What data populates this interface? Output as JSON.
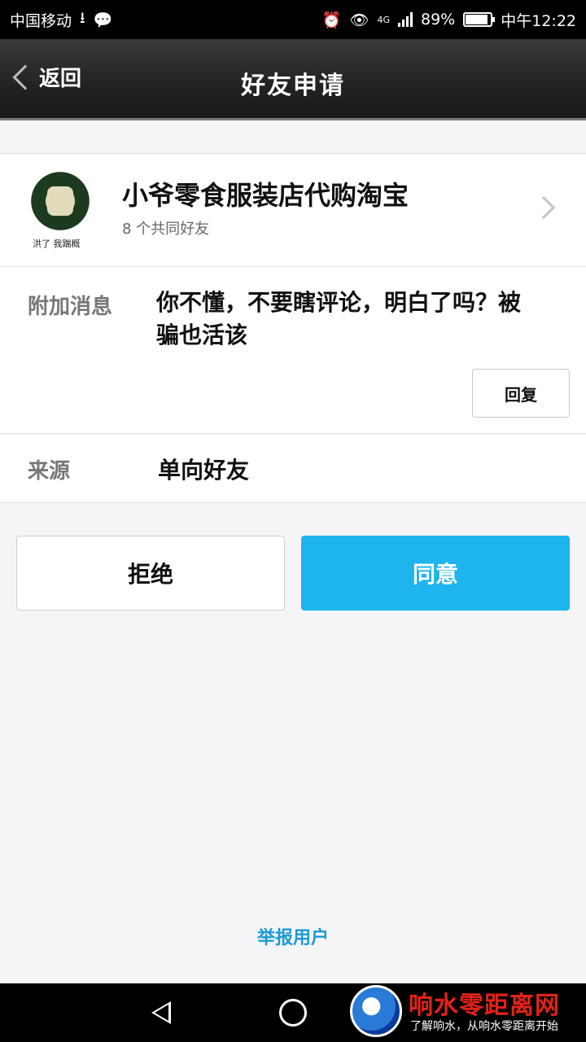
{
  "status_bar": {
    "carrier": "中国移动",
    "battery": "89%",
    "battery_level": 0.89,
    "network": "4G",
    "time": "中午12:22",
    "icons": [
      "download-icon",
      "wechat-icon",
      "alarm-icon",
      "eye-icon",
      "signal-icon",
      "battery-icon"
    ]
  },
  "header": {
    "back_label": "返回",
    "title": "好友申请"
  },
  "profile": {
    "name": "小爷零食服装店代购淘宝",
    "mutual_friends": "8 个共同好友",
    "avatar_caption": "洪了 我踹概"
  },
  "message": {
    "label": "附加消息",
    "text": "你不懂，不要瞎评论，明白了吗？被骗也活该",
    "reply_label": "回复"
  },
  "source": {
    "label": "来源",
    "value": "单向好友"
  },
  "actions": {
    "reject_label": "拒绝",
    "accept_label": "同意",
    "accent_color": "#1eb4ee"
  },
  "report_label": "举报用户",
  "watermark": {
    "title": "响水零距离网",
    "subtitle": "了解响水，从响水零距离开始"
  }
}
